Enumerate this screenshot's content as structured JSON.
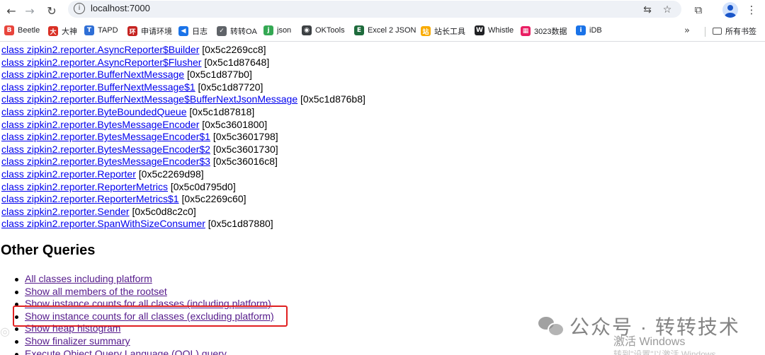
{
  "browser": {
    "url": "localhost:7000",
    "icons": {
      "back": "arrow-left-icon",
      "forward": "arrow-right-icon",
      "reload": "reload-icon",
      "info": "info-icon",
      "translate": "translate-icon",
      "bookmark": "star-icon",
      "extensions": "puzzle-icon",
      "profile": "profile-icon",
      "menu": "more-vertical-icon"
    }
  },
  "bookmarks": {
    "items": [
      {
        "label": "Beetle",
        "icon_color": "#e8453c",
        "icon_glyph": "B"
      },
      {
        "label": "大神",
        "icon_color": "#d93025",
        "icon_glyph": "大"
      },
      {
        "label": "TAPD",
        "icon_color": "#2f6fd6",
        "icon_glyph": "T"
      },
      {
        "label": "申请环境",
        "icon_color": "#c5221f",
        "icon_glyph": "环"
      },
      {
        "label": "日志",
        "icon_color": "#1a73e8",
        "icon_glyph": "◀"
      },
      {
        "label": "转转OA",
        "icon_color": "#5f6368",
        "icon_glyph": "✓"
      },
      {
        "label": "json",
        "icon_color": "#34a853",
        "icon_glyph": "j"
      },
      {
        "label": "OKTools",
        "icon_color": "#3c4043",
        "icon_glyph": "◉"
      },
      {
        "label": "Excel 2 JSON",
        "icon_color": "#1e6b3c",
        "icon_glyph": "E"
      },
      {
        "label": "站长工具",
        "icon_color": "#f9ab00",
        "icon_glyph": "站"
      },
      {
        "label": "Whistle",
        "icon_color": "#202124",
        "icon_glyph": "W"
      },
      {
        "label": "3023数据",
        "icon_color": "#e91e63",
        "icon_glyph": "▦"
      },
      {
        "label": "iDB",
        "icon_color": "#1a73e8",
        "icon_glyph": "i"
      }
    ],
    "more": "»",
    "folder_label": "所有书签"
  },
  "classes": [
    {
      "name": "class zipkin2.reporter.AsyncReporter$Builder",
      "addr": "[0x5c2269cc8]"
    },
    {
      "name": "class zipkin2.reporter.AsyncReporter$Flusher",
      "addr": "[0x5c1d87648]"
    },
    {
      "name": "class zipkin2.reporter.BufferNextMessage",
      "addr": "[0x5c1d877b0]"
    },
    {
      "name": "class zipkin2.reporter.BufferNextMessage$1",
      "addr": "[0x5c1d87720]"
    },
    {
      "name": "class zipkin2.reporter.BufferNextMessage$BufferNextJsonMessage",
      "addr": "[0x5c1d876b8]"
    },
    {
      "name": "class zipkin2.reporter.ByteBoundedQueue",
      "addr": "[0x5c1d87818]"
    },
    {
      "name": "class zipkin2.reporter.BytesMessageEncoder",
      "addr": "[0x5c3601800]"
    },
    {
      "name": "class zipkin2.reporter.BytesMessageEncoder$1",
      "addr": "[0x5c3601798]"
    },
    {
      "name": "class zipkin2.reporter.BytesMessageEncoder$2",
      "addr": "[0x5c3601730]"
    },
    {
      "name": "class zipkin2.reporter.BytesMessageEncoder$3",
      "addr": "[0x5c36016c8]"
    },
    {
      "name": "class zipkin2.reporter.Reporter",
      "addr": "[0x5c2269d98]"
    },
    {
      "name": "class zipkin2.reporter.ReporterMetrics",
      "addr": "[0x5c0d795d0]"
    },
    {
      "name": "class zipkin2.reporter.ReporterMetrics$1",
      "addr": "[0x5c2269c60]"
    },
    {
      "name": "class zipkin2.reporter.Sender",
      "addr": "[0x5c0d8c2c0]"
    },
    {
      "name": "class zipkin2.reporter.SpanWithSizeConsumer",
      "addr": "[0x5c1d87880]"
    }
  ],
  "other_queries": {
    "title": "Other Queries",
    "items": [
      "All classes including platform",
      "Show all members of the rootset",
      "Show instance counts for all classes (including platform)",
      "Show instance counts for all classes (excluding platform)",
      "Show heap histogram",
      "Show finalizer summary",
      "Execute Object Query Language (OQL) query"
    ],
    "highlighted_index": 3,
    "highlight_color": "#e02020"
  },
  "watermark": {
    "brand": "公众号 · 转转技术",
    "windows_line1": "激活 Windows",
    "windows_line2": "转到\"设置\"以激活 Windows。"
  }
}
